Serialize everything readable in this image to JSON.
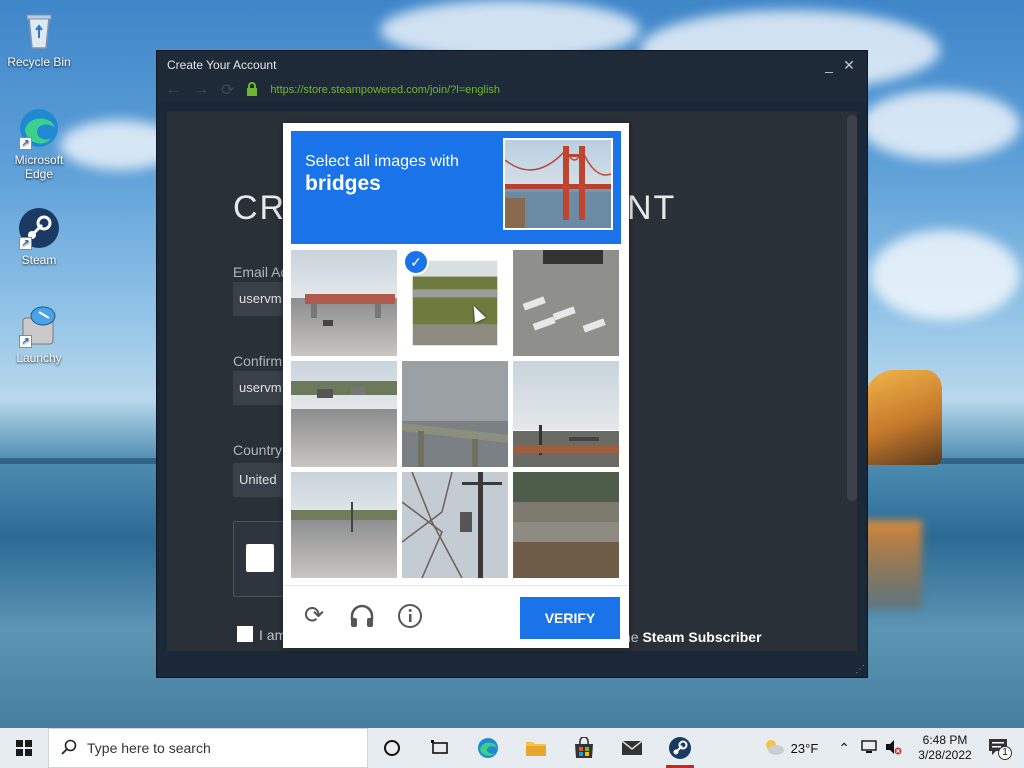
{
  "desktop": {
    "icons": [
      {
        "label": "Recycle Bin"
      },
      {
        "label": "Microsoft Edge"
      },
      {
        "label": "Steam"
      },
      {
        "label": "Launchy"
      }
    ]
  },
  "window": {
    "title": "Create Your Account",
    "minimize": "_",
    "close": "✕",
    "url": "https://store.steampowered.com/join/?l=english"
  },
  "page": {
    "title_start": "CRE",
    "title_end": "NT",
    "email_label": "Email Ad",
    "email_value": "uservm",
    "confirm_label": "Confirm",
    "confirm_value": "uservm",
    "country_label": "Country",
    "country_value": "United",
    "agree_start": "I am",
    "agree_end_prefix": "he ",
    "agree_end_bold": "Steam Subscriber"
  },
  "captcha": {
    "instruction": "Select all images with",
    "target": "bridges",
    "verify_label": "VERIFY",
    "selected_tiles": [
      1
    ]
  },
  "taskbar": {
    "search_placeholder": "Type here to search",
    "weather": "23°F",
    "time": "6:48 PM",
    "date": "3/28/2022",
    "notifications": "1"
  },
  "colors": {
    "accent": "#1a73e8",
    "steam_url": "#6fb82b"
  }
}
